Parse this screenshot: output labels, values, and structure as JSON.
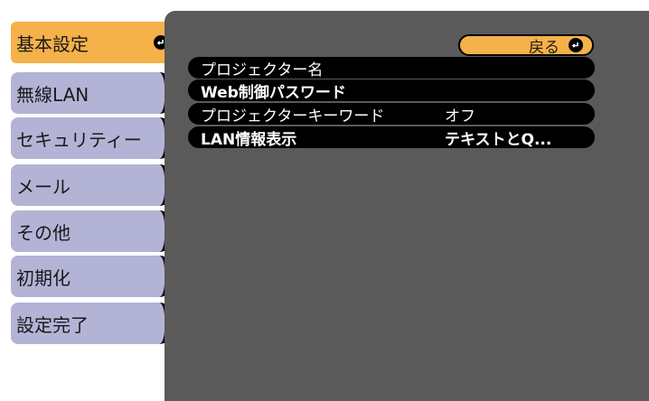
{
  "menu": {
    "items": [
      {
        "label": "基本設定",
        "selected": true
      },
      {
        "label": "無線LAN"
      },
      {
        "label": "セキュリティー"
      },
      {
        "label": "メール"
      },
      {
        "label": "その他"
      },
      {
        "label": "初期化"
      },
      {
        "label": "設定完了"
      }
    ]
  },
  "back_button": {
    "label": "戻る"
  },
  "settings": [
    {
      "name": "プロジェクター名",
      "value": ""
    },
    {
      "name": "Web制御パスワード",
      "value": ""
    },
    {
      "name": "プロジェクターキーワード",
      "value": "オフ"
    },
    {
      "name": "LAN情報表示",
      "value": "テキストとQ..."
    }
  ],
  "colors": {
    "selected_bg": "#f5b14a",
    "menu_bg": "#b3b3d6",
    "panel_bg": "#5a5a5a",
    "row_bg": "#000000"
  },
  "icons": {
    "enter": "enter-icon"
  }
}
